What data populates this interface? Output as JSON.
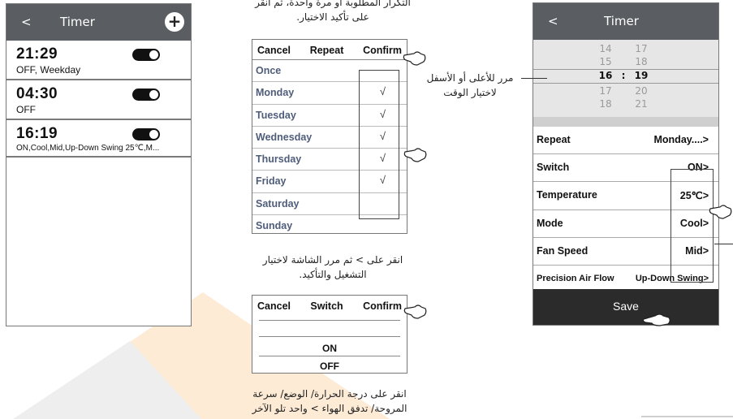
{
  "phone1": {
    "back": "<",
    "title": "Timer",
    "add": "+",
    "timers": [
      {
        "time": "21:29",
        "desc": "OFF, Weekday",
        "on": true
      },
      {
        "time": "04:30",
        "desc": "OFF",
        "on": true
      },
      {
        "time": "16:19",
        "desc": "ON,Cool,Mid,Up-Down Swing 25℃,M...",
        "on": true
      }
    ]
  },
  "captions": {
    "top": "التكرار المطلوبة أو مرة واحدة، ثم انقر",
    "top2": "على تأكيد الاختيار.",
    "middle1": "انقر على > ثم مرر الشاشة لاختيار",
    "middle2": "التشغيل والتأكيد.",
    "bottom1": "انقر على درجة الحرارة/ الوضع/ سرعة",
    "bottom2": "المروحة/ تدفق الهواء > واحد تلو الآخر",
    "scroll1": "مرر للأعلى أو الأسفل",
    "scroll2": "لاختيار الوقت"
  },
  "repeat_dialog": {
    "cancel": "Cancel",
    "repeat": "Repeat",
    "confirm": "Confirm",
    "days": [
      {
        "label": "Once",
        "checked": false
      },
      {
        "label": "Monday",
        "checked": true
      },
      {
        "label": "Tuesday",
        "checked": true
      },
      {
        "label": "Wednesday",
        "checked": true
      },
      {
        "label": "Thursday",
        "checked": true
      },
      {
        "label": "Friday",
        "checked": true
      },
      {
        "label": "Saturday",
        "checked": false
      },
      {
        "label": "Sunday",
        "checked": false
      }
    ],
    "check_mark": "√"
  },
  "switch_dialog": {
    "cancel": "Cancel",
    "switch": "Switch",
    "confirm": "Confirm",
    "on": "ON",
    "off": "OFF"
  },
  "phone2": {
    "back": "<",
    "title": "Timer",
    "wheel": {
      "hours": [
        "14",
        "15",
        "16",
        "17",
        "18"
      ],
      "minutes": [
        "17",
        "18",
        "19",
        "20",
        "21"
      ],
      "sep": ":"
    },
    "settings": [
      {
        "label": "Repeat",
        "value": "Monday....>"
      },
      {
        "label": "Switch",
        "value": "ON>"
      },
      {
        "label": "Temperature",
        "value": "25℃>"
      },
      {
        "label": "Mode",
        "value": "Cool>"
      },
      {
        "label": "Fan Speed",
        "value": "Mid>"
      },
      {
        "label": "Precision Air Flow",
        "value": "Up-Down Swing>"
      }
    ],
    "save": "Save"
  },
  "colors": {
    "header": "#5a5d61",
    "day_text": "#4f5d7a",
    "save_bar": "#2b2b2b",
    "bg_accent": "#fdebd6"
  }
}
